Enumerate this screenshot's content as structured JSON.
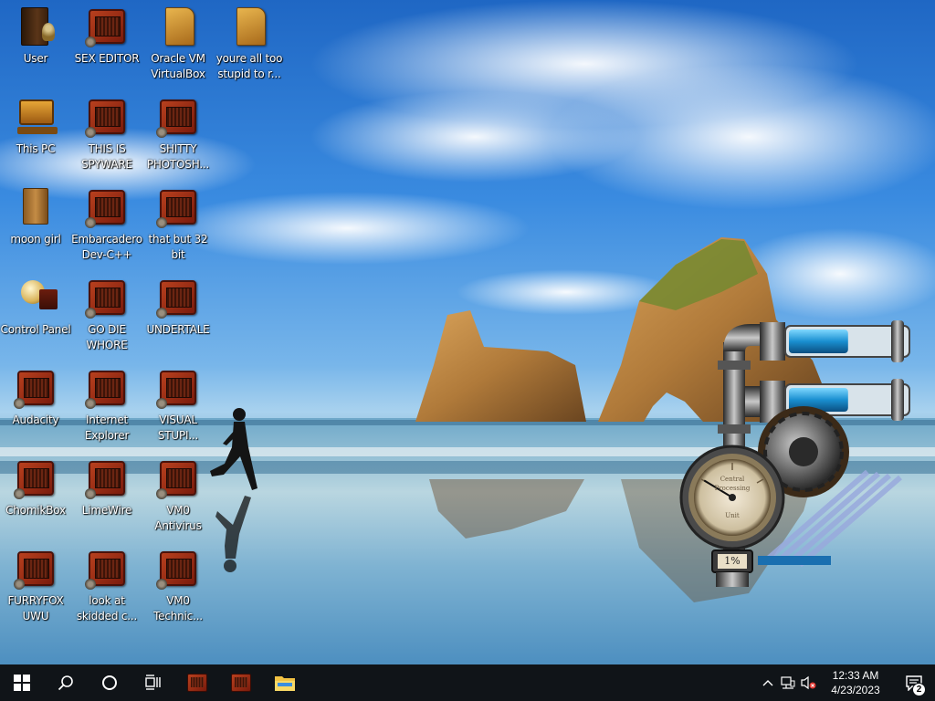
{
  "desktop": {
    "icons": [
      {
        "label": "User",
        "kind": "book"
      },
      {
        "label": "SEX EDITOR",
        "kind": "app"
      },
      {
        "label": "Oracle VM VirtualBox",
        "kind": "doc"
      },
      {
        "label": "youre all too stupid to r...",
        "kind": "doc"
      },
      {
        "label": "This PC",
        "kind": "pc"
      },
      {
        "label": "THIS IS SPYWARE",
        "kind": "app"
      },
      {
        "label": "SHITTY PHOTOSH...",
        "kind": "app"
      },
      {
        "label": "moon girl",
        "kind": "box"
      },
      {
        "label": "Embarcadero Dev-C++",
        "kind": "app"
      },
      {
        "label": "that but 32 bit",
        "kind": "app"
      },
      {
        "label": "Control Panel",
        "kind": "bulb"
      },
      {
        "label": "GO DIE WHORE",
        "kind": "app"
      },
      {
        "label": "UNDERTALE",
        "kind": "app"
      },
      {
        "label": "Audacity",
        "kind": "app"
      },
      {
        "label": "Internet Explorer",
        "kind": "app"
      },
      {
        "label": "VISUAL STUPI...",
        "kind": "app"
      },
      {
        "label": "ChomikBox",
        "kind": "app"
      },
      {
        "label": "LimeWire",
        "kind": "app"
      },
      {
        "label": "VM0 Antivirus",
        "kind": "app"
      },
      {
        "label": "FURRYFOX UWU",
        "kind": "app"
      },
      {
        "label": "look at skidded c...",
        "kind": "app"
      },
      {
        "label": "VM0 Technic...",
        "kind": "app"
      }
    ]
  },
  "gadget": {
    "gauge_label_top": "Central",
    "gauge_label_mid": "Processing",
    "gauge_label_bottom": "Unit",
    "cpu_value": "1%",
    "cpu_usage_fraction": 0.01,
    "memory_fill_fraction": 0.6,
    "disk_fill_fraction": 0.6
  },
  "taskbar": {
    "start_icon": "windows-logo-icon",
    "search_icon": "search-icon",
    "cortana_icon": "cortana-circle-icon",
    "taskview_icon": "task-view-icon",
    "pinned": [
      "app-icon",
      "app-icon",
      "file-explorer-icon"
    ],
    "clock_time": "12:33 AM",
    "clock_date": "4/23/2023",
    "notification_count": "2",
    "colors": {
      "taskbar_bg": "#101418",
      "accent": "#ffffff"
    }
  }
}
